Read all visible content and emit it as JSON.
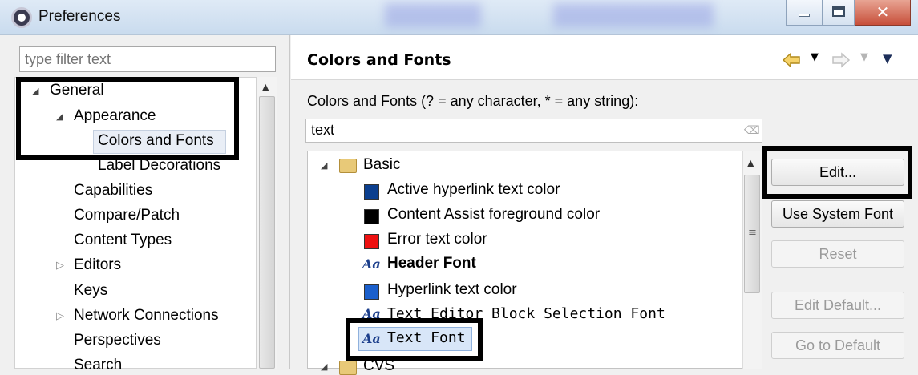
{
  "window": {
    "title": "Preferences",
    "close_glyph": "✕"
  },
  "left": {
    "filter_placeholder": "type filter text",
    "tree": [
      {
        "label": "General"
      },
      {
        "label": "Appearance"
      },
      {
        "label": "Colors and Fonts"
      },
      {
        "label": "Label Decorations"
      },
      {
        "label": "Capabilities"
      },
      {
        "label": "Compare/Patch"
      },
      {
        "label": "Content Types"
      },
      {
        "label": "Editors"
      },
      {
        "label": "Keys"
      },
      {
        "label": "Network Connections"
      },
      {
        "label": "Perspectives"
      },
      {
        "label": "Search"
      }
    ]
  },
  "right": {
    "heading": "Colors and Fonts",
    "description": "Colors and Fonts (? = any character, * = any string):",
    "search_value": "text",
    "group_basic": "Basic",
    "group_cvs": "CVS",
    "items": [
      {
        "label": "Active hyperlink text color",
        "kind": "color",
        "color": "#0b3f8f"
      },
      {
        "label": "Content Assist foreground color",
        "kind": "color",
        "color": "#000000"
      },
      {
        "label": "Error text color",
        "kind": "color",
        "color": "#ee1111"
      },
      {
        "label": "Header Font",
        "kind": "font"
      },
      {
        "label": "Hyperlink text color",
        "kind": "color",
        "color": "#1a5fcc"
      },
      {
        "label": "Text Editor Block Selection Font",
        "kind": "font"
      },
      {
        "label": "Text Font",
        "kind": "font"
      }
    ],
    "font_icon_glyph": "Aa"
  },
  "buttons": {
    "edit": "Edit...",
    "use_system_font": "Use System Font",
    "reset": "Reset",
    "edit_default": "Edit Default...",
    "go_to_default": "Go to Default"
  }
}
